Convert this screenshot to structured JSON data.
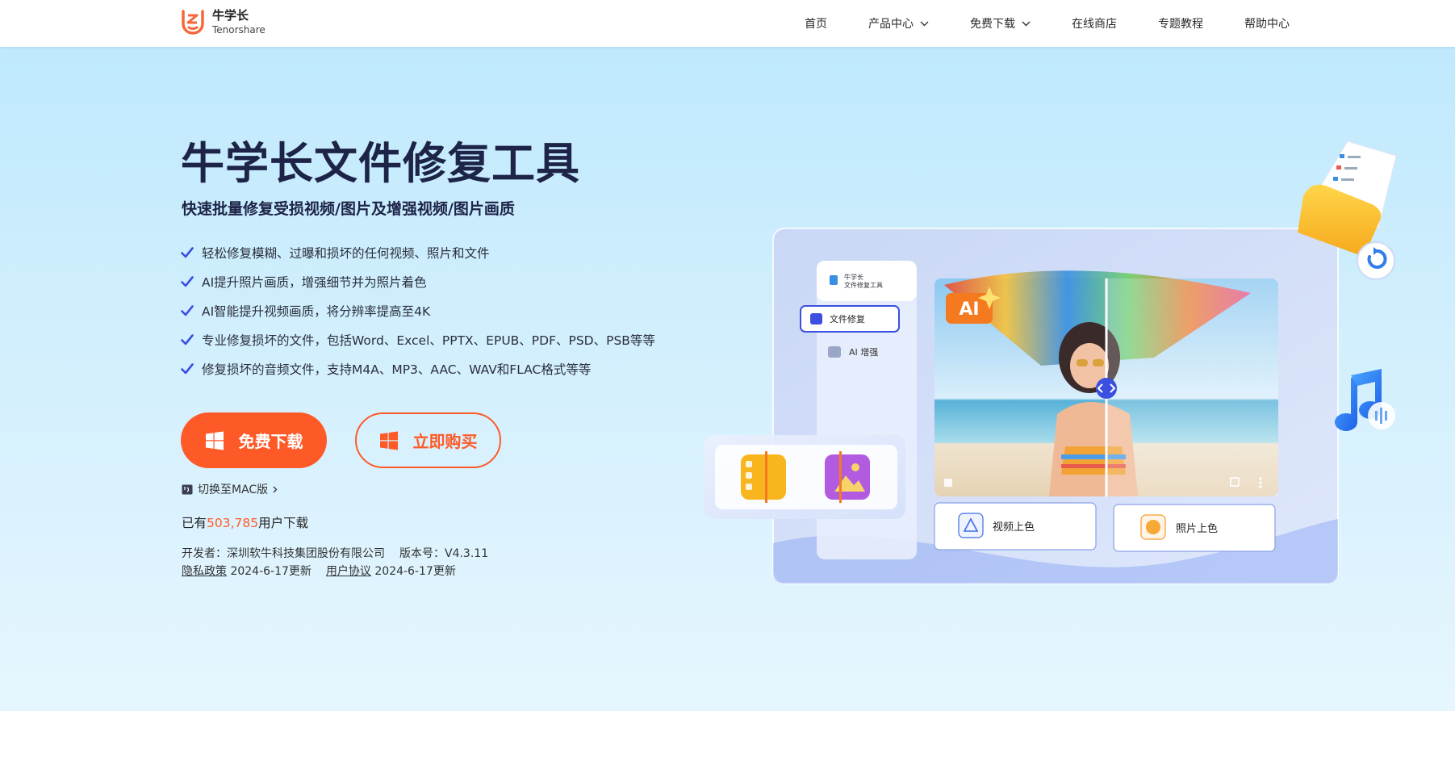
{
  "brand": {
    "name_cn": "牛学长",
    "name_en": "Tenorshare",
    "color": "#fe5a27"
  },
  "nav": [
    {
      "label": "首页",
      "has_dropdown": false
    },
    {
      "label": "产品中心",
      "has_dropdown": true
    },
    {
      "label": "免费下载",
      "has_dropdown": true
    },
    {
      "label": "在线商店",
      "has_dropdown": false
    },
    {
      "label": "专题教程",
      "has_dropdown": false
    },
    {
      "label": "帮助中心",
      "has_dropdown": false
    }
  ],
  "hero": {
    "title": "牛学长文件修复工具",
    "subtitle": "快速批量修复受损视频/图片及增强视频/图片画质",
    "features": [
      "轻松修复模糊、过曝和损坏的任何视频、照片和文件",
      "AI提升照片画质，增强细节并为照片着色",
      "AI智能提升视频画质，将分辨率提高至4K",
      "专业修复损坏的文件，包括Word、Excel、PPTX、EPUB、PDF、PSD、PSB等等",
      "修复损坏的音频文件，支持M4A、MP3、AAC、WAV和FLAC格式等等"
    ],
    "download_button": "免费下载",
    "buy_button": "立即购买",
    "mac_switch": "切换至MAC版",
    "downloads_prefix": "已有",
    "downloads_count": "503,785",
    "downloads_suffix": "用户下载",
    "developer": "开发者：深圳软牛科技集团股份有限公司",
    "version": "版本号：V4.3.11",
    "privacy_label": "隐私政策",
    "privacy_date": "2024-6-17更新",
    "terms_label": "用户协议",
    "terms_date": "2024-6-17更新"
  },
  "mockup": {
    "app_name_line1": "牛学长",
    "app_name_line2": "文件修复工具",
    "menu_repair": "文件修复",
    "menu_enhance": "AI 增强",
    "ai_badge": "AI",
    "card_video_color": "视频上色",
    "card_photo_color": "照片上色"
  },
  "colors": {
    "accent": "#fe5a27",
    "title": "#1d2447",
    "check": "#3b4fe0",
    "hero_bg": "#c8ecfd"
  }
}
